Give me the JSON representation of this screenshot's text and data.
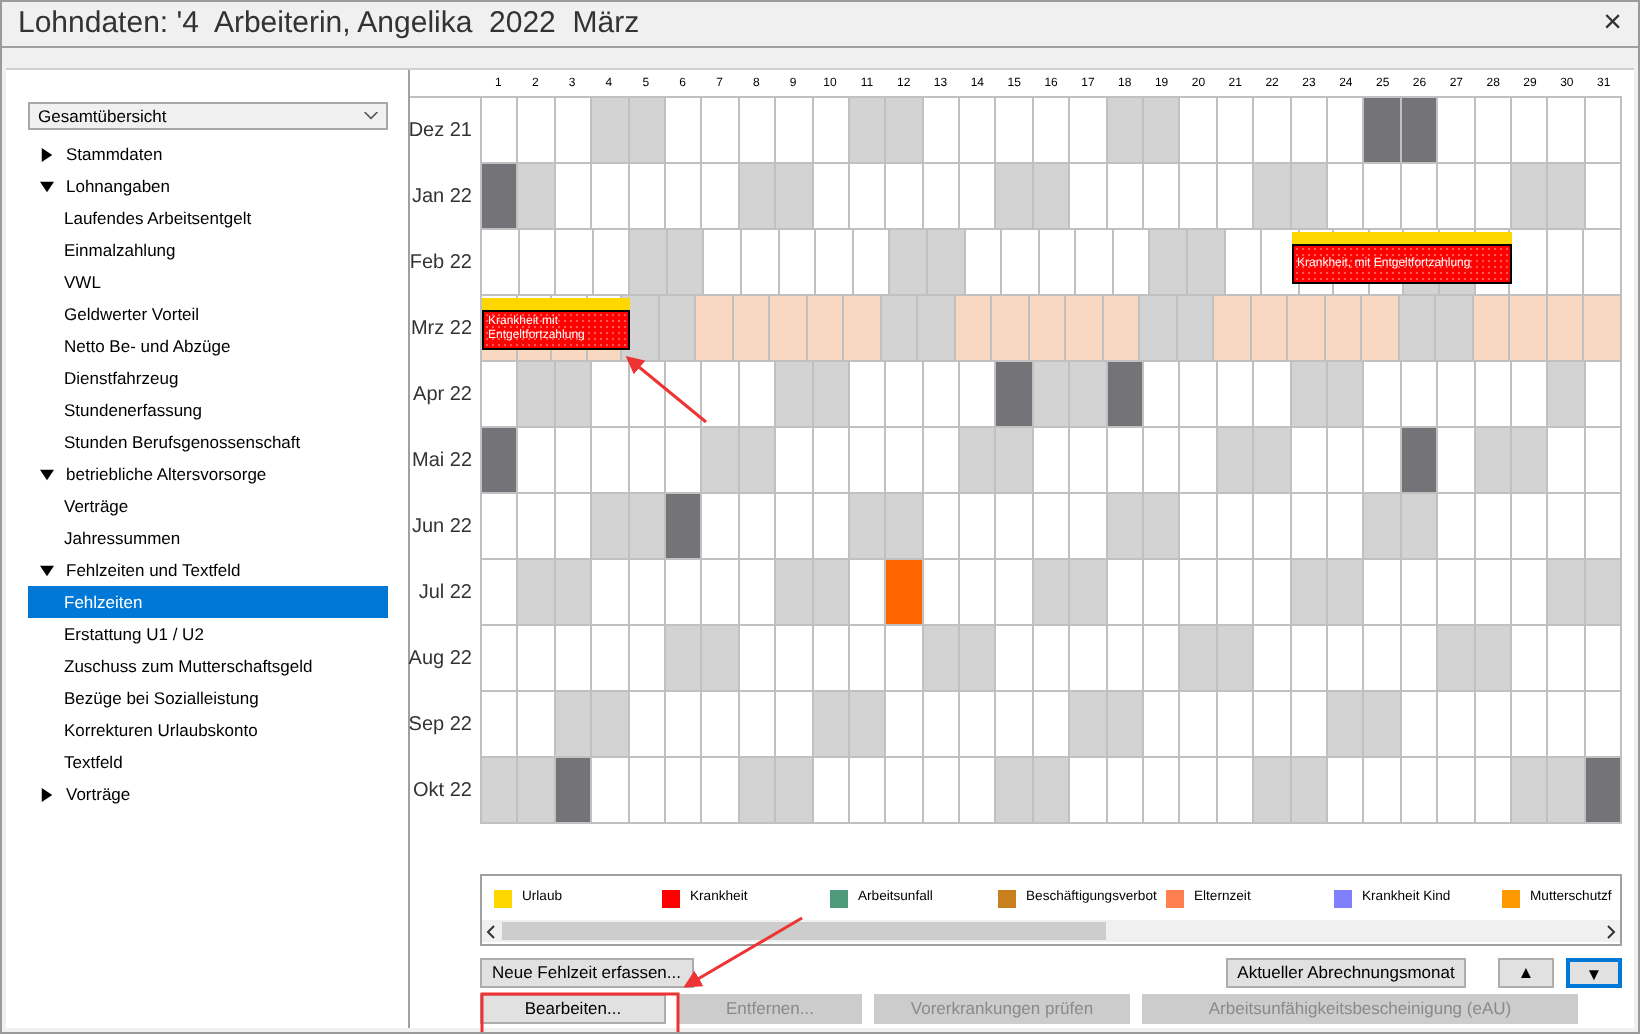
{
  "window": {
    "title": "Lohndaten: '4  Arbeiterin, Angelika  2022  März",
    "close": "×"
  },
  "view_select": {
    "value": "Gesamtübersicht"
  },
  "tree": [
    {
      "label": "Stammdaten",
      "expanded": false,
      "selected": false
    },
    {
      "label": "Lohnangaben",
      "expanded": true,
      "selected": false,
      "children": [
        {
          "label": "Laufendes Arbeitsentgelt",
          "selected": false
        },
        {
          "label": "Einmalzahlung",
          "selected": false
        },
        {
          "label": "VWL",
          "selected": false
        },
        {
          "label": "Geldwerter Vorteil",
          "selected": false
        },
        {
          "label": "Netto Be- und Abzüge",
          "selected": false
        },
        {
          "label": "Dienstfahrzeug",
          "selected": false
        },
        {
          "label": "Stundenerfassung",
          "selected": false
        },
        {
          "label": "Stunden Berufsgenossenschaft",
          "selected": false
        }
      ]
    },
    {
      "label": "betriebliche Altersvorsorge",
      "expanded": true,
      "selected": false,
      "children": [
        {
          "label": "Verträge",
          "selected": false
        },
        {
          "label": "Jahressummen",
          "selected": false
        }
      ]
    },
    {
      "label": "Fehlzeiten und Textfeld",
      "expanded": true,
      "selected": false,
      "children": [
        {
          "label": "Fehlzeiten",
          "selected": true
        },
        {
          "label": "Erstattung U1 / U2",
          "selected": false
        },
        {
          "label": "Zuschuss zum Mutterschaftsgeld",
          "selected": false
        },
        {
          "label": "Bezüge bei Sozialleistung",
          "selected": false
        },
        {
          "label": "Korrekturen Urlaubskonto",
          "selected": false
        },
        {
          "label": "Textfeld",
          "selected": false
        }
      ]
    },
    {
      "label": "Vorträge",
      "expanded": false,
      "selected": false
    }
  ],
  "calendar": {
    "days": [
      "1",
      "2",
      "3",
      "4",
      "5",
      "6",
      "7",
      "8",
      "9",
      "10",
      "11",
      "12",
      "13",
      "14",
      "15",
      "16",
      "17",
      "18",
      "19",
      "20",
      "21",
      "22",
      "23",
      "24",
      "25",
      "26",
      "27",
      "28",
      "29",
      "30",
      "31"
    ],
    "months": [
      {
        "label": "Dez 21",
        "cells": [
          {
            "kind": "work"
          },
          {
            "kind": "work"
          },
          {
            "kind": "work"
          },
          {
            "kind": "weekend"
          },
          {
            "kind": "weekend"
          },
          {
            "kind": "work"
          },
          {
            "kind": "work"
          },
          {
            "kind": "work"
          },
          {
            "kind": "work"
          },
          {
            "kind": "work"
          },
          {
            "kind": "weekend"
          },
          {
            "kind": "weekend"
          },
          {
            "kind": "work"
          },
          {
            "kind": "work"
          },
          {
            "kind": "work"
          },
          {
            "kind": "work"
          },
          {
            "kind": "work"
          },
          {
            "kind": "weekend"
          },
          {
            "kind": "weekend"
          },
          {
            "kind": "work"
          },
          {
            "kind": "work"
          },
          {
            "kind": "work"
          },
          {
            "kind": "work"
          },
          {
            "kind": "work"
          },
          {
            "kind": "holiday"
          },
          {
            "kind": "holiday"
          },
          {
            "kind": "work"
          },
          {
            "kind": "work"
          },
          {
            "kind": "work"
          },
          {
            "kind": "work"
          },
          {
            "kind": "work"
          }
        ]
      },
      {
        "label": "Jan 22",
        "cells": [
          {
            "kind": "holiday"
          },
          {
            "kind": "weekend"
          },
          {
            "kind": "work"
          },
          {
            "kind": "work"
          },
          {
            "kind": "work"
          },
          {
            "kind": "work"
          },
          {
            "kind": "work"
          },
          {
            "kind": "weekend"
          },
          {
            "kind": "weekend"
          },
          {
            "kind": "work"
          },
          {
            "kind": "work"
          },
          {
            "kind": "work"
          },
          {
            "kind": "work"
          },
          {
            "kind": "work"
          },
          {
            "kind": "weekend"
          },
          {
            "kind": "weekend"
          },
          {
            "kind": "work"
          },
          {
            "kind": "work"
          },
          {
            "kind": "work"
          },
          {
            "kind": "work"
          },
          {
            "kind": "work"
          },
          {
            "kind": "weekend"
          },
          {
            "kind": "weekend"
          },
          {
            "kind": "work"
          },
          {
            "kind": "work"
          },
          {
            "kind": "work"
          },
          {
            "kind": "work"
          },
          {
            "kind": "work"
          },
          {
            "kind": "weekend"
          },
          {
            "kind": "weekend"
          },
          {
            "kind": "work"
          }
        ]
      },
      {
        "label": "Feb 22",
        "cells": [
          {
            "kind": "work"
          },
          {
            "kind": "work"
          },
          {
            "kind": "work"
          },
          {
            "kind": "work"
          },
          {
            "kind": "weekend"
          },
          {
            "kind": "weekend"
          },
          {
            "kind": "work"
          },
          {
            "kind": "work"
          },
          {
            "kind": "work"
          },
          {
            "kind": "work"
          },
          {
            "kind": "work"
          },
          {
            "kind": "weekend"
          },
          {
            "kind": "weekend"
          },
          {
            "kind": "work"
          },
          {
            "kind": "work"
          },
          {
            "kind": "work"
          },
          {
            "kind": "work"
          },
          {
            "kind": "work"
          },
          {
            "kind": "weekend"
          },
          {
            "kind": "weekend"
          },
          {
            "kind": "work"
          },
          {
            "kind": "work"
          },
          {
            "kind": "work",
            "covered": true
          },
          {
            "kind": "work",
            "covered": true
          },
          {
            "kind": "work",
            "covered": true
          },
          {
            "kind": "weekend",
            "covered": true
          },
          {
            "kind": "weekend",
            "covered": true
          },
          {
            "kind": "work",
            "covered": true
          },
          {
            "kind": "work"
          },
          {
            "kind": "work"
          },
          {
            "kind": "work"
          }
        ],
        "absences": [
          {
            "label": "Krankheit, mit Entgeltfortzahlung",
            "color": "#ff0000",
            "band": {
              "color": "#ffd700"
            }
          }
        ]
      },
      {
        "label": "Mrz 22",
        "cells": [
          {
            "kind": "period",
            "covered": true
          },
          {
            "kind": "period",
            "covered": true
          },
          {
            "kind": "period",
            "covered": true
          },
          {
            "kind": "period",
            "covered": true
          },
          {
            "kind": "weekend"
          },
          {
            "kind": "weekend"
          },
          {
            "kind": "period"
          },
          {
            "kind": "period"
          },
          {
            "kind": "period"
          },
          {
            "kind": "period"
          },
          {
            "kind": "period"
          },
          {
            "kind": "weekend"
          },
          {
            "kind": "weekend"
          },
          {
            "kind": "period"
          },
          {
            "kind": "period"
          },
          {
            "kind": "period"
          },
          {
            "kind": "period"
          },
          {
            "kind": "period"
          },
          {
            "kind": "weekend"
          },
          {
            "kind": "weekend"
          },
          {
            "kind": "period"
          },
          {
            "kind": "period"
          },
          {
            "kind": "period"
          },
          {
            "kind": "period"
          },
          {
            "kind": "period"
          },
          {
            "kind": "weekend"
          },
          {
            "kind": "weekend"
          },
          {
            "kind": "period"
          },
          {
            "kind": "period"
          },
          {
            "kind": "period"
          },
          {
            "kind": "period"
          }
        ],
        "absences": [
          {
            "label": "Krankheit mit Entgeltfortzahlung",
            "color": "#ff0000",
            "band": {
              "color": "#ffd700"
            }
          }
        ]
      },
      {
        "label": "Apr 22",
        "cells": [
          {
            "kind": "work"
          },
          {
            "kind": "weekend"
          },
          {
            "kind": "weekend"
          },
          {
            "kind": "work"
          },
          {
            "kind": "work"
          },
          {
            "kind": "work"
          },
          {
            "kind": "work"
          },
          {
            "kind": "work"
          },
          {
            "kind": "weekend"
          },
          {
            "kind": "weekend"
          },
          {
            "kind": "work"
          },
          {
            "kind": "work"
          },
          {
            "kind": "work"
          },
          {
            "kind": "work"
          },
          {
            "kind": "holiday"
          },
          {
            "kind": "weekend"
          },
          {
            "kind": "weekend"
          },
          {
            "kind": "holiday"
          },
          {
            "kind": "work"
          },
          {
            "kind": "work"
          },
          {
            "kind": "work"
          },
          {
            "kind": "work"
          },
          {
            "kind": "weekend"
          },
          {
            "kind": "weekend"
          },
          {
            "kind": "work"
          },
          {
            "kind": "work"
          },
          {
            "kind": "work"
          },
          {
            "kind": "work"
          },
          {
            "kind": "work"
          },
          {
            "kind": "weekend"
          },
          {
            "kind": "work"
          }
        ]
      },
      {
        "label": "Mai 22",
        "cells": [
          {
            "kind": "holiday"
          },
          {
            "kind": "work"
          },
          {
            "kind": "work"
          },
          {
            "kind": "work"
          },
          {
            "kind": "work"
          },
          {
            "kind": "work"
          },
          {
            "kind": "weekend"
          },
          {
            "kind": "weekend"
          },
          {
            "kind": "work"
          },
          {
            "kind": "work"
          },
          {
            "kind": "work"
          },
          {
            "kind": "work"
          },
          {
            "kind": "work"
          },
          {
            "kind": "weekend"
          },
          {
            "kind": "weekend"
          },
          {
            "kind": "work"
          },
          {
            "kind": "work"
          },
          {
            "kind": "work"
          },
          {
            "kind": "work"
          },
          {
            "kind": "work"
          },
          {
            "kind": "weekend"
          },
          {
            "kind": "weekend"
          },
          {
            "kind": "work"
          },
          {
            "kind": "work"
          },
          {
            "kind": "work"
          },
          {
            "kind": "holiday"
          },
          {
            "kind": "work"
          },
          {
            "kind": "weekend"
          },
          {
            "kind": "weekend"
          },
          {
            "kind": "work"
          },
          {
            "kind": "work"
          }
        ]
      },
      {
        "label": "Jun 22",
        "cells": [
          {
            "kind": "work"
          },
          {
            "kind": "work"
          },
          {
            "kind": "work"
          },
          {
            "kind": "weekend"
          },
          {
            "kind": "weekend"
          },
          {
            "kind": "holiday"
          },
          {
            "kind": "work"
          },
          {
            "kind": "work"
          },
          {
            "kind": "work"
          },
          {
            "kind": "work"
          },
          {
            "kind": "weekend"
          },
          {
            "kind": "weekend"
          },
          {
            "kind": "work"
          },
          {
            "kind": "work"
          },
          {
            "kind": "work"
          },
          {
            "kind": "work"
          },
          {
            "kind": "work"
          },
          {
            "kind": "weekend"
          },
          {
            "kind": "weekend"
          },
          {
            "kind": "work"
          },
          {
            "kind": "work"
          },
          {
            "kind": "work"
          },
          {
            "kind": "work"
          },
          {
            "kind": "work"
          },
          {
            "kind": "weekend"
          },
          {
            "kind": "weekend"
          },
          {
            "kind": "work"
          },
          {
            "kind": "work"
          },
          {
            "kind": "work"
          },
          {
            "kind": "work"
          },
          {
            "kind": "work"
          }
        ]
      },
      {
        "label": "Jul 22",
        "cells": [
          {
            "kind": "work"
          },
          {
            "kind": "weekend"
          },
          {
            "kind": "weekend"
          },
          {
            "kind": "work"
          },
          {
            "kind": "work"
          },
          {
            "kind": "work"
          },
          {
            "kind": "work"
          },
          {
            "kind": "work"
          },
          {
            "kind": "weekend"
          },
          {
            "kind": "weekend"
          },
          {
            "kind": "work"
          },
          {
            "kind": "marked",
            "color": "#ff6600"
          },
          {
            "kind": "work"
          },
          {
            "kind": "work"
          },
          {
            "kind": "work"
          },
          {
            "kind": "weekend"
          },
          {
            "kind": "weekend"
          },
          {
            "kind": "work"
          },
          {
            "kind": "work"
          },
          {
            "kind": "work"
          },
          {
            "kind": "work"
          },
          {
            "kind": "work"
          },
          {
            "kind": "weekend"
          },
          {
            "kind": "weekend"
          },
          {
            "kind": "work"
          },
          {
            "kind": "work"
          },
          {
            "kind": "work"
          },
          {
            "kind": "work"
          },
          {
            "kind": "work"
          },
          {
            "kind": "weekend"
          },
          {
            "kind": "weekend"
          }
        ]
      },
      {
        "label": "Aug 22",
        "cells": [
          {
            "kind": "work"
          },
          {
            "kind": "work"
          },
          {
            "kind": "work"
          },
          {
            "kind": "work"
          },
          {
            "kind": "work"
          },
          {
            "kind": "weekend"
          },
          {
            "kind": "weekend"
          },
          {
            "kind": "work"
          },
          {
            "kind": "work"
          },
          {
            "kind": "work"
          },
          {
            "kind": "work"
          },
          {
            "kind": "work"
          },
          {
            "kind": "weekend"
          },
          {
            "kind": "weekend"
          },
          {
            "kind": "work"
          },
          {
            "kind": "work"
          },
          {
            "kind": "work"
          },
          {
            "kind": "work"
          },
          {
            "kind": "work"
          },
          {
            "kind": "weekend"
          },
          {
            "kind": "weekend"
          },
          {
            "kind": "work"
          },
          {
            "kind": "work"
          },
          {
            "kind": "work"
          },
          {
            "kind": "work"
          },
          {
            "kind": "work"
          },
          {
            "kind": "weekend"
          },
          {
            "kind": "weekend"
          },
          {
            "kind": "work"
          },
          {
            "kind": "work"
          },
          {
            "kind": "work"
          }
        ]
      },
      {
        "label": "Sep 22",
        "cells": [
          {
            "kind": "work"
          },
          {
            "kind": "work"
          },
          {
            "kind": "weekend"
          },
          {
            "kind": "weekend"
          },
          {
            "kind": "work"
          },
          {
            "kind": "work"
          },
          {
            "kind": "work"
          },
          {
            "kind": "work"
          },
          {
            "kind": "work"
          },
          {
            "kind": "weekend"
          },
          {
            "kind": "weekend"
          },
          {
            "kind": "work"
          },
          {
            "kind": "work"
          },
          {
            "kind": "work"
          },
          {
            "kind": "work"
          },
          {
            "kind": "work"
          },
          {
            "kind": "weekend"
          },
          {
            "kind": "weekend"
          },
          {
            "kind": "work"
          },
          {
            "kind": "work"
          },
          {
            "kind": "work"
          },
          {
            "kind": "work"
          },
          {
            "kind": "work"
          },
          {
            "kind": "weekend"
          },
          {
            "kind": "weekend"
          },
          {
            "kind": "work"
          },
          {
            "kind": "work"
          },
          {
            "kind": "work"
          },
          {
            "kind": "work"
          },
          {
            "kind": "work"
          },
          {
            "kind": "work"
          }
        ]
      },
      {
        "label": "Okt 22",
        "cells": [
          {
            "kind": "weekend"
          },
          {
            "kind": "weekend"
          },
          {
            "kind": "holiday"
          },
          {
            "kind": "work"
          },
          {
            "kind": "work"
          },
          {
            "kind": "work"
          },
          {
            "kind": "work"
          },
          {
            "kind": "weekend"
          },
          {
            "kind": "weekend"
          },
          {
            "kind": "work"
          },
          {
            "kind": "work"
          },
          {
            "kind": "work"
          },
          {
            "kind": "work"
          },
          {
            "kind": "work"
          },
          {
            "kind": "weekend"
          },
          {
            "kind": "weekend"
          },
          {
            "kind": "work"
          },
          {
            "kind": "work"
          },
          {
            "kind": "work"
          },
          {
            "kind": "work"
          },
          {
            "kind": "work"
          },
          {
            "kind": "weekend"
          },
          {
            "kind": "weekend"
          },
          {
            "kind": "work"
          },
          {
            "kind": "work"
          },
          {
            "kind": "work"
          },
          {
            "kind": "work"
          },
          {
            "kind": "work"
          },
          {
            "kind": "weekend"
          },
          {
            "kind": "weekend"
          },
          {
            "kind": "holiday"
          }
        ]
      }
    ]
  },
  "legend": [
    {
      "label": "Urlaub",
      "color": "#ffd700"
    },
    {
      "label": "Krankheit",
      "color": "#ff0000"
    },
    {
      "label": "Arbeitsunfall",
      "color": "#4e9a7a"
    },
    {
      "label": "Beschäftigungsverbot",
      "color": "#c8801e"
    },
    {
      "label": "Elternzeit",
      "color": "#ff7f4f"
    },
    {
      "label": "Krankheit Kind",
      "color": "#8080ff"
    },
    {
      "label": "Mutterschutzf",
      "color": "#ff9900"
    }
  ],
  "buttons_top": [
    {
      "label": "Neue Fehlzeit erfassen...",
      "disabled": false
    }
  ],
  "buttons_right": [
    {
      "label": "Aktueller Abrechnungsmonat",
      "focused": false
    },
    {
      "label": "▲",
      "focused": false
    },
    {
      "label": "▼",
      "focused": true
    }
  ],
  "buttons_bottom": [
    {
      "label": "Bearbeiten...",
      "disabled": false
    },
    {
      "label": "Entfernen...",
      "disabled": true
    },
    {
      "label": "Vorerkrankungen prüfen",
      "disabled": true
    },
    {
      "label": "Arbeitsunfähigkeitsbescheinigung (eAU)",
      "disabled": true
    }
  ]
}
